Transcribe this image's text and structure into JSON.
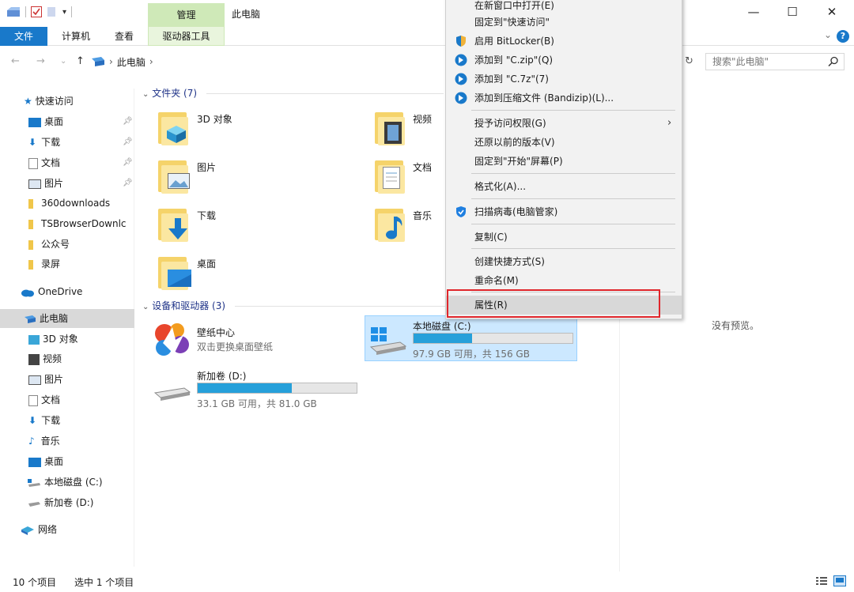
{
  "titlebar": {
    "context_tab": "管理",
    "title": "此电脑",
    "minimize": "—",
    "maximize": "☐",
    "close": "✕"
  },
  "ribbon": {
    "tabs": [
      "文件",
      "计算机",
      "查看",
      "驱动器工具"
    ],
    "collapse": "⌄",
    "help": "?"
  },
  "address": {
    "path": "此电脑",
    "search_placeholder": "搜索\"此电脑\""
  },
  "sidebar": {
    "quick_access": "快速访问",
    "items": [
      {
        "label": "桌面",
        "pinned": true
      },
      {
        "label": "下载",
        "pinned": true
      },
      {
        "label": "文档",
        "pinned": true
      },
      {
        "label": "图片",
        "pinned": true
      },
      {
        "label": "360downloads"
      },
      {
        "label": "TSBrowserDownlc"
      },
      {
        "label": "公众号"
      },
      {
        "label": "录屏"
      }
    ],
    "onedrive": "OneDrive",
    "this_pc": "此电脑",
    "pc_items": [
      "3D 对象",
      "视频",
      "图片",
      "文档",
      "下载",
      "音乐",
      "桌面",
      "本地磁盘 (C:)",
      "新加卷 (D:)"
    ],
    "network": "网络"
  },
  "content": {
    "folders_group": "文件夹 (7)",
    "folders": [
      "3D 对象",
      "视频",
      "图片",
      "文档",
      "下载",
      "音乐",
      "桌面"
    ],
    "devices_group": "设备和驱动器 (3)",
    "wallpaper": {
      "name": "壁纸中心",
      "sub": "双击更换桌面壁纸"
    },
    "drive_c": {
      "name": "本地磁盘 (C:)",
      "free": "97.9 GB 可用，共 156 GB",
      "used_fraction": 0.37
    },
    "drive_d": {
      "name": "新加卷 (D:)",
      "free": "33.1 GB 可用，共 81.0 GB",
      "used_fraction": 0.59
    },
    "no_preview": "没有预览。"
  },
  "menu": {
    "items": [
      {
        "label": "在新窗口中打开(E)"
      },
      {
        "label": "固定到\"快速访问\""
      },
      {
        "label": "启用 BitLocker(B)",
        "icon": "shield-icon"
      },
      {
        "label": "添加到 \"C.zip\"(Q)",
        "icon": "bandizip-icon"
      },
      {
        "label": "添加到 \"C.7z\"(7)",
        "icon": "bandizip-icon"
      },
      {
        "label": "添加到压缩文件 (Bandizip)(L)...",
        "icon": "bandizip-icon"
      },
      {
        "label": "授予访问权限(G)",
        "submenu": true
      },
      {
        "label": "还原以前的版本(V)"
      },
      {
        "label": "固定到\"开始\"屏幕(P)"
      },
      {
        "label": "格式化(A)..."
      },
      {
        "label": "扫描病毒(电脑管家)",
        "icon": "tencent-guard-icon"
      },
      {
        "label": "复制(C)"
      },
      {
        "label": "创建快捷方式(S)"
      },
      {
        "label": "重命名(M)"
      },
      {
        "label": "属性(R)"
      }
    ]
  },
  "status": {
    "count": "10 个项目",
    "selected": "选中 1 个项目"
  },
  "colors": {
    "accent": "#1979ca",
    "drive_fill": "#26a0da",
    "highlight_border": "#e0262b",
    "context_tab": "#cfe9b8"
  }
}
